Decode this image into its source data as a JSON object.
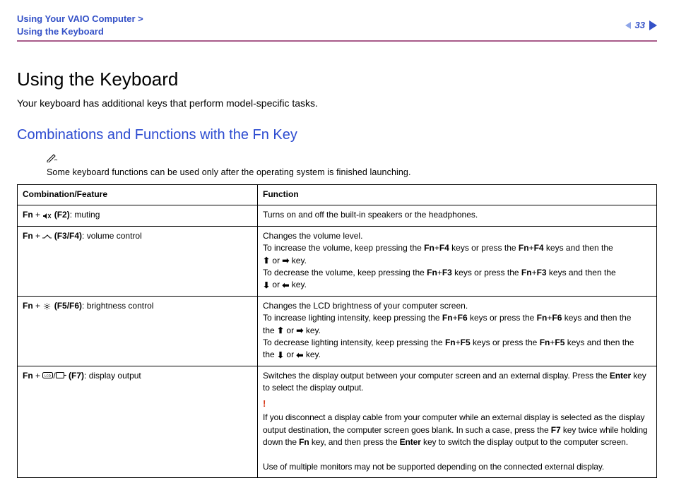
{
  "header": {
    "breadcrumb_line1": "Using Your VAIO Computer >",
    "breadcrumb_line2": "Using the Keyboard",
    "page_number": "33"
  },
  "title": "Using the Keyboard",
  "intro": "Your keyboard has additional keys that perform model-specific tasks.",
  "subhead": "Combinations and Functions with the Fn Key",
  "note": {
    "icon": "✎",
    "text": "Some keyboard functions can be used only after the operating system is finished launching."
  },
  "table": {
    "head_left": "Combination/Feature",
    "head_right": "Function",
    "rows": [
      {
        "left_prefix": "Fn",
        "left_plus": " + ",
        "left_key": " (F2)",
        "left_desc": ": muting",
        "right_simple": "Turns on and off the built-in speakers or the headphones."
      },
      {
        "left_prefix": "Fn",
        "left_plus": " + ",
        "left_key": " (F3/F4)",
        "left_desc": ": volume control",
        "r_line1": "Changes the volume level.",
        "r_inc_a": "To increase the volume, keep pressing the ",
        "r_inc_b": " keys or press the ",
        "r_inc_c": " keys and then the ",
        "r_inc_key1": "Fn",
        "r_inc_plus1": "+",
        "r_inc_key2": "F4",
        "r_inc_key3": "Fn",
        "r_inc_plus2": "+",
        "r_inc_key4": "F4",
        "r_or": " or ",
        "r_keyend": " key.",
        "r_dec_a": "To decrease the volume, keep pressing the ",
        "r_dec_b": " keys or press the ",
        "r_dec_c": " keys and then the ",
        "r_dec_key1": "Fn",
        "r_dec_plus1": "+",
        "r_dec_key2": "F3",
        "r_dec_key3": "Fn",
        "r_dec_plus2": "+",
        "r_dec_key4": "F3"
      },
      {
        "left_prefix": "Fn",
        "left_plus": " + ",
        "left_key": " (F5/F6)",
        "left_desc": ": brightness control",
        "r_line1": "Changes the LCD brightness of your computer screen.",
        "r_inc_a": "To increase lighting intensity, keep pressing the ",
        "r_inc_b": " keys or press the ",
        "r_inc_c": " keys and then the ",
        "r_inc_key1": "Fn",
        "r_inc_plus1": "+",
        "r_inc_key2": "F6",
        "r_inc_key3": "Fn",
        "r_inc_plus2": "+",
        "r_inc_key4": "F6",
        "r_or": " or ",
        "r_keyend": " key.",
        "r_dec_a": "To decrease lighting intensity, keep pressing the ",
        "r_dec_b": " keys or press the ",
        "r_dec_c": " keys and then the ",
        "r_dec_key1": "Fn",
        "r_dec_plus1": "+",
        "r_dec_key2": "F5",
        "r_dec_key3": "Fn",
        "r_dec_plus2": "+",
        "r_dec_key4": "F5"
      },
      {
        "left_prefix": "Fn",
        "left_plus": " + ",
        "left_slash": "/",
        "left_key": " (F7)",
        "left_desc": ": display output",
        "r_p1a": "Switches the display output between your computer screen and an external display. Press the ",
        "r_p1_key": "Enter",
        "r_p1b": " key to select the display output.",
        "r_warn": "!",
        "r_p2a": "If you disconnect a display cable from your computer while an external display is selected as the display output destination, the computer screen goes blank. In such a case, press the ",
        "r_p2_key1": "F7",
        "r_p2b": " key twice while holding down the ",
        "r_p2_key2": "Fn",
        "r_p2c": " key, and then press the ",
        "r_p2_key3": "Enter",
        "r_p2d": " key to switch the display output to the computer screen.",
        "r_p3": "Use of multiple monitors may not be supported depending on the connected external display."
      }
    ]
  }
}
